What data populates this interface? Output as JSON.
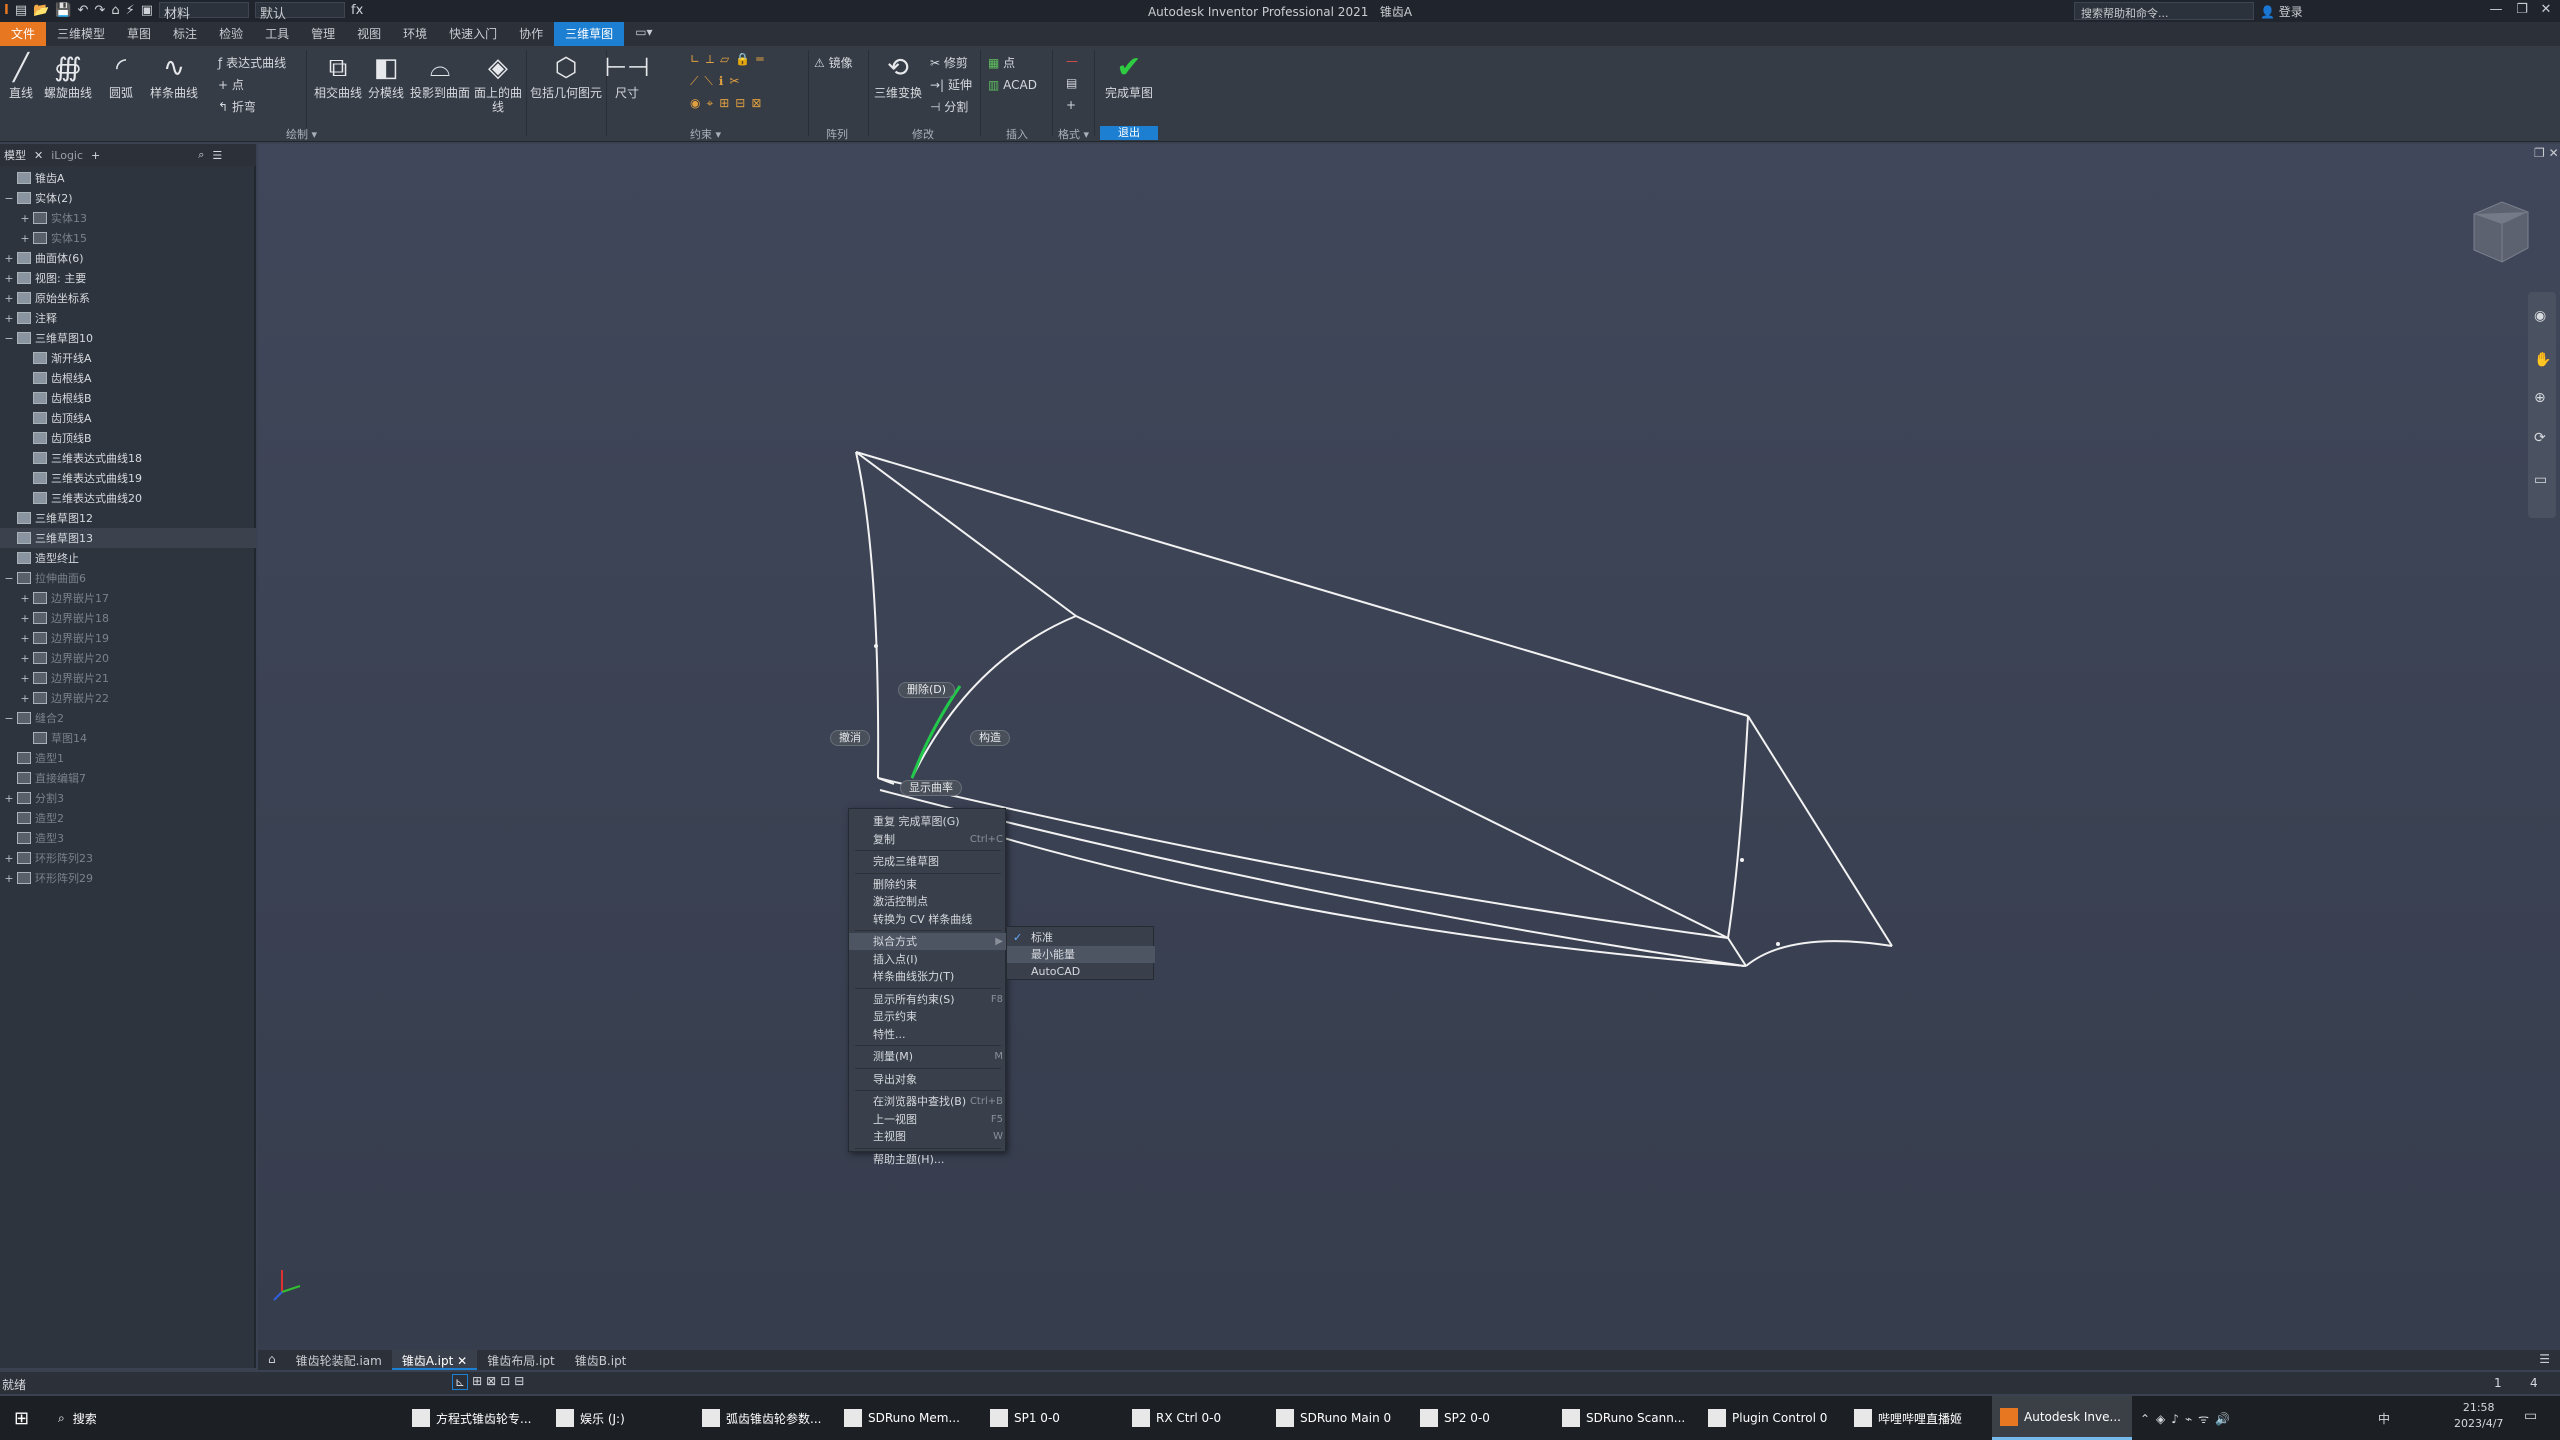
{
  "titlebar": {
    "app_title": "Autodesk Inventor Professional 2021",
    "doc_title": "锥齿A",
    "qat_material": "材料",
    "qat_appearance": "默认",
    "help_search": "搜索帮助和命令...",
    "login": "登录"
  },
  "menu": {
    "tabs": [
      "文件",
      "三维模型",
      "草图",
      "标注",
      "检验",
      "工具",
      "管理",
      "视图",
      "环境",
      "快速入门",
      "协作",
      "三维草图"
    ]
  },
  "ribbon": {
    "draw": {
      "line": "直线",
      "helix": "螺旋曲线",
      "arc": "圆弧",
      "spline": "样条曲线",
      "eq_curve": "表达式曲线",
      "point": "点",
      "bend": "折弯",
      "intersect": "相交曲线",
      "silhouette": "分模线",
      "project": "投影到曲面",
      "on_face": "面上的曲线",
      "include": "包括几何图元",
      "label": "绘制"
    },
    "constraint": {
      "dimension": "尺寸",
      "label": "约束"
    },
    "pattern": {
      "mirror": "镜像",
      "label": "阵列"
    },
    "modify": {
      "transform": "三维变换",
      "trim": "修剪",
      "extend": "延伸",
      "split": "分割",
      "label": "修改"
    },
    "insert": {
      "point": "点",
      "acad": "ACAD",
      "label": "插入"
    },
    "format": {
      "label": "格式"
    },
    "exit": {
      "finish": "完成草图",
      "label": "退出"
    }
  },
  "browser": {
    "tabs": [
      "模型",
      "iLogic"
    ],
    "tree": [
      {
        "label": "锥齿A",
        "level": 0,
        "exp": "",
        "dim": false
      },
      {
        "label": "实体(2)",
        "level": 0,
        "exp": "−",
        "dim": false
      },
      {
        "label": "实体13",
        "level": 1,
        "exp": "+",
        "dim": true
      },
      {
        "label": "实体15",
        "level": 1,
        "exp": "+",
        "dim": true
      },
      {
        "label": "曲面体(6)",
        "level": 0,
        "exp": "+",
        "dim": false
      },
      {
        "label": "视图: 主要",
        "level": 0,
        "exp": "+",
        "dim": false
      },
      {
        "label": "原始坐标系",
        "level": 0,
        "exp": "+",
        "dim": false
      },
      {
        "label": "注释",
        "level": 0,
        "exp": "+",
        "dim": false
      },
      {
        "label": "三维草图10",
        "level": 0,
        "exp": "−",
        "dim": false
      },
      {
        "label": "渐开线A",
        "level": 1,
        "exp": "",
        "dim": false
      },
      {
        "label": "齿根线A",
        "level": 1,
        "exp": "",
        "dim": false
      },
      {
        "label": "齿根线B",
        "level": 1,
        "exp": "",
        "dim": false
      },
      {
        "label": "齿顶线A",
        "level": 1,
        "exp": "",
        "dim": false
      },
      {
        "label": "齿顶线B",
        "level": 1,
        "exp": "",
        "dim": false
      },
      {
        "label": "三维表达式曲线18",
        "level": 1,
        "exp": "",
        "dim": false
      },
      {
        "label": "三维表达式曲线19",
        "level": 1,
        "exp": "",
        "dim": false
      },
      {
        "label": "三维表达式曲线20",
        "level": 1,
        "exp": "",
        "dim": false
      },
      {
        "label": "三维草图12",
        "level": 0,
        "exp": "",
        "dim": false
      },
      {
        "label": "三维草图13",
        "level": 0,
        "exp": "",
        "dim": false,
        "hl": true
      },
      {
        "label": "造型终止",
        "level": 0,
        "exp": "",
        "dim": false
      },
      {
        "label": "拉伸曲面6",
        "level": 0,
        "exp": "−",
        "dim": true
      },
      {
        "label": "边界嵌片17",
        "level": 1,
        "exp": "+",
        "dim": true
      },
      {
        "label": "边界嵌片18",
        "level": 1,
        "exp": "+",
        "dim": true
      },
      {
        "label": "边界嵌片19",
        "level": 1,
        "exp": "+",
        "dim": true
      },
      {
        "label": "边界嵌片20",
        "level": 1,
        "exp": "+",
        "dim": true
      },
      {
        "label": "边界嵌片21",
        "level": 1,
        "exp": "+",
        "dim": true
      },
      {
        "label": "边界嵌片22",
        "level": 1,
        "exp": "+",
        "dim": true
      },
      {
        "label": "缝合2",
        "level": 0,
        "exp": "−",
        "dim": true
      },
      {
        "label": "草图14",
        "level": 1,
        "exp": "",
        "dim": true
      },
      {
        "label": "造型1",
        "level": 0,
        "exp": "",
        "dim": true
      },
      {
        "label": "直接编辑7",
        "level": 0,
        "exp": "",
        "dim": true
      },
      {
        "label": "分割3",
        "level": 0,
        "exp": "+",
        "dim": true
      },
      {
        "label": "造型2",
        "level": 0,
        "exp": "",
        "dim": true
      },
      {
        "label": "造型3",
        "level": 0,
        "exp": "",
        "dim": true
      },
      {
        "label": "环形阵列23",
        "level": 0,
        "exp": "+",
        "dim": true
      },
      {
        "label": "环形阵列29",
        "level": 0,
        "exp": "+",
        "dim": true
      }
    ]
  },
  "canvas": {
    "mini_buttons": {
      "delete": "删除(D)",
      "undo": "撤消",
      "construct": "构造",
      "show_curvature": "显示曲率"
    }
  },
  "context_menu": {
    "items": [
      {
        "label": "重复 完成草图(G)",
        "sc": ""
      },
      {
        "label": "复制",
        "sc": "Ctrl+C"
      },
      {
        "label": "完成三维草图",
        "sc": ""
      },
      {
        "label": "删除约束",
        "sc": ""
      },
      {
        "label": "激活控制点",
        "sc": ""
      },
      {
        "label": "转换为 CV 样条曲线",
        "sc": ""
      },
      {
        "label": "拟合方式",
        "sc": "▶"
      },
      {
        "label": "插入点(I)",
        "sc": ""
      },
      {
        "label": "样条曲线张力(T)",
        "sc": ""
      },
      {
        "label": "显示所有约束(S)",
        "sc": "F8"
      },
      {
        "label": "显示约束",
        "sc": ""
      },
      {
        "label": "特性...",
        "sc": ""
      },
      {
        "label": "测量(M)",
        "sc": "M"
      },
      {
        "label": "导出对象",
        "sc": ""
      },
      {
        "label": "在浏览器中查找(B)",
        "sc": "Ctrl+B"
      },
      {
        "label": "上一视图",
        "sc": "F5"
      },
      {
        "label": "主视图",
        "sc": "W"
      },
      {
        "label": "帮助主题(H)...",
        "sc": ""
      }
    ],
    "submenu": [
      "标准",
      "最小能量",
      "AutoCAD"
    ]
  },
  "doc_tabs": [
    "锥齿轮装配.iam",
    "锥齿A.ipt",
    "锥齿布局.ipt",
    "锥齿B.ipt"
  ],
  "status": {
    "text": "就绪",
    "page_a": "1",
    "page_b": "4"
  },
  "taskbar": {
    "search": "搜索",
    "apps": [
      "方程式锥齿轮专...",
      "娱乐 (J:)",
      "弧齿锥齿轮参数...",
      "SDRuno Mem...",
      "SP1 0-0",
      "RX Ctrl 0-0",
      "SDRuno Main 0",
      "SP2 0-0",
      "SDRuno Scann...",
      "Plugin Control 0",
      "哔哩哔哩直播姬",
      "Autodesk Inve..."
    ],
    "time": "21:58",
    "date": "2023/4/7",
    "ime": "中"
  },
  "colors": {
    "accent": "#1d7fd1",
    "file_tab": "#e87722",
    "curve_highlight": "#22c84a",
    "check": "#2ecc40"
  }
}
